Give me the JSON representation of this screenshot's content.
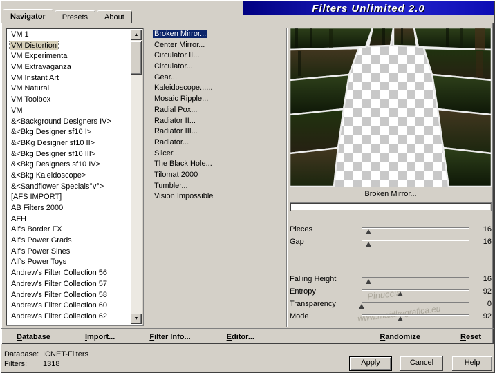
{
  "window": {
    "title": "Filters Unlimited 2.0"
  },
  "tabs": [
    {
      "label": "Navigator"
    },
    {
      "label": "Presets"
    },
    {
      "label": "About"
    }
  ],
  "categories": {
    "selected_index": 1,
    "items": [
      "VM 1",
      "VM Distortion",
      "VM Experimental",
      "VM Extravaganza",
      "VM Instant Art",
      "VM Natural",
      "VM Toolbox",
      "VM",
      "&<Background Designers IV>",
      "&<Bkg Designer sf10 I>",
      "&<BKg Designer sf10 II>",
      "&<Bkg Designer sf10 III>",
      "&<Bkg Designers sf10 IV>",
      "&<Bkg Kaleidoscope>",
      "&<Sandflower Specials°v°>",
      "[AFS IMPORT]",
      "AB Filters 2000",
      "AFH",
      "Alf's Border FX",
      "Alf's Power Grads",
      "Alf's Power Sines",
      "Alf's Power Toys",
      "Andrew's Filter Collection 56",
      "Andrew's Filter Collection 57",
      "Andrew's Filter Collection 58",
      "Andrew's Filter Collection 60",
      "Andrew's Filter Collection 62"
    ]
  },
  "filters_list": {
    "selected_index": 0,
    "items": [
      "Broken Mirror...",
      "Center Mirror...",
      "Circulator II...",
      "Circulator...",
      "Gear...",
      "Kaleidoscope......",
      "Mosaic Ripple...",
      "Radial Pox...",
      "Radiator II...",
      "Radiator III...",
      "Radiator...",
      "Slicer...",
      "The Black Hole...",
      "Tilomat 2000",
      "Tumbler...",
      "Vision Impossible"
    ]
  },
  "preview": {
    "caption": "Broken Mirror...",
    "watermark_line1": "Pinuccia",
    "watermark_line2": "www.maidiregrafica.eu"
  },
  "sliders": [
    {
      "label": "Pieces",
      "value": 16
    },
    {
      "label": "Gap",
      "value": 16
    },
    {
      "label": "Falling Height",
      "value": 16
    },
    {
      "label": "Entropy",
      "value": 92
    },
    {
      "label": "Transparency",
      "value": 0
    },
    {
      "label": "Mode",
      "value": 92
    }
  ],
  "actions": {
    "database": "Database",
    "import": "Import...",
    "filter_info": "Filter Info...",
    "editor": "Editor...",
    "randomize": "Randomize",
    "reset": "Reset"
  },
  "status": {
    "database_label": "Database:",
    "database_value": "ICNET-Filters",
    "filters_label": "Filters:",
    "filters_value": "1318"
  },
  "dialog_buttons": {
    "apply": "Apply",
    "cancel": "Cancel",
    "help": "Help"
  },
  "icons": {
    "scroll_up": "▲",
    "scroll_down": "▼"
  },
  "colors": {
    "selection_blue": "#0a246a",
    "category_selection": "#d6cfb8",
    "title_gradient_start": "#000082",
    "title_gradient_end": "#2323cc"
  }
}
